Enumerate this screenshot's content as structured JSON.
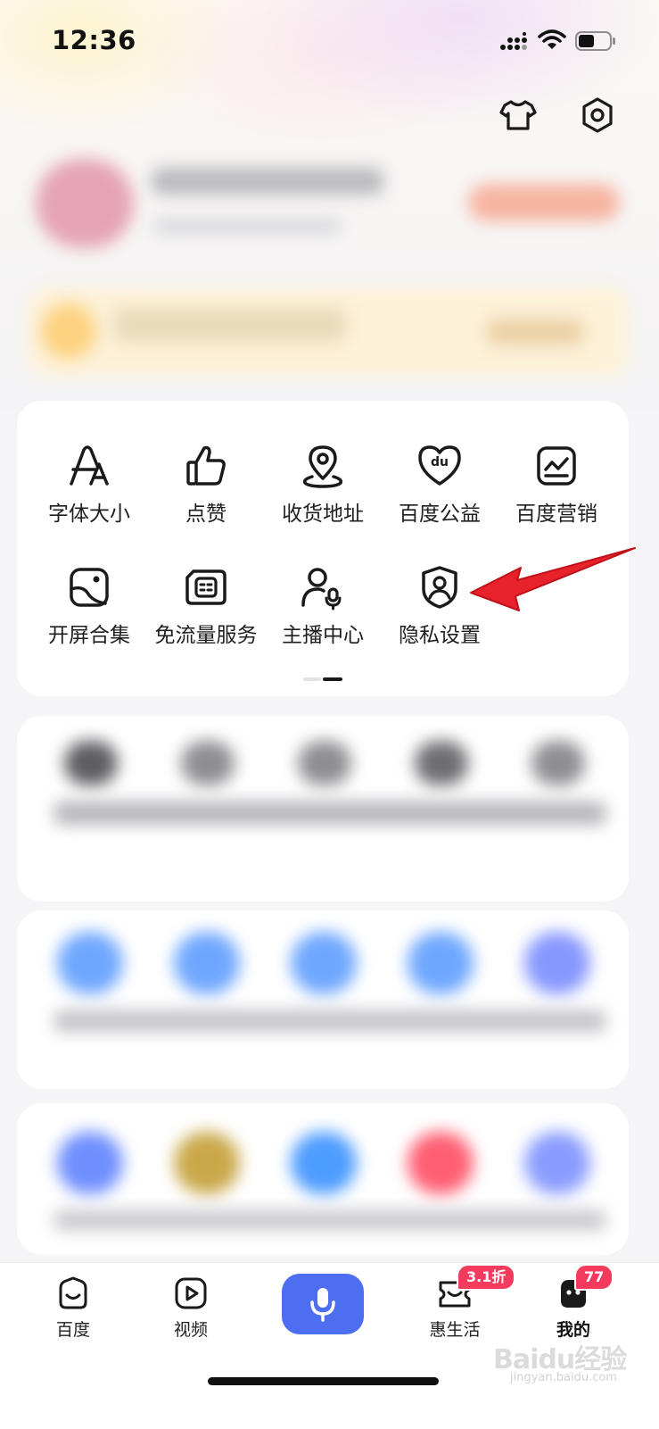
{
  "status_bar": {
    "time": "12:36"
  },
  "header": {
    "icons": [
      "tshirt-icon",
      "settings-hexagon-icon"
    ]
  },
  "tools": [
    {
      "label": "字体大小",
      "icon": "font-size-icon"
    },
    {
      "label": "点赞",
      "icon": "thumbs-up-icon"
    },
    {
      "label": "收货地址",
      "icon": "location-pin-icon"
    },
    {
      "label": "百度公益",
      "icon": "heart-du-icon"
    },
    {
      "label": "百度营销",
      "icon": "marketing-chart-icon"
    },
    {
      "label": "开屏合集",
      "icon": "splash-image-icon"
    },
    {
      "label": "免流量服务",
      "icon": "sim-card-icon"
    },
    {
      "label": "主播中心",
      "icon": "streamer-mic-icon"
    },
    {
      "label": "隐私设置",
      "icon": "privacy-shield-icon"
    }
  ],
  "bottom_nav": {
    "items": [
      {
        "label": "百度",
        "icon": "baidu-home-icon"
      },
      {
        "label": "视频",
        "icon": "video-play-icon"
      },
      {
        "label": "",
        "icon": "mic-icon"
      },
      {
        "label": "惠生活",
        "icon": "life-ticket-icon",
        "badge": "3.1折"
      },
      {
        "label": "我的",
        "icon": "my-face-icon",
        "badge": "77"
      }
    ]
  },
  "watermark": {
    "text": "Baidu经验",
    "sub": "jingyan.baidu.com"
  },
  "colors": {
    "accent": "#4e6ef2",
    "badge": "#f43a5d",
    "annotation": "#e8222a"
  }
}
